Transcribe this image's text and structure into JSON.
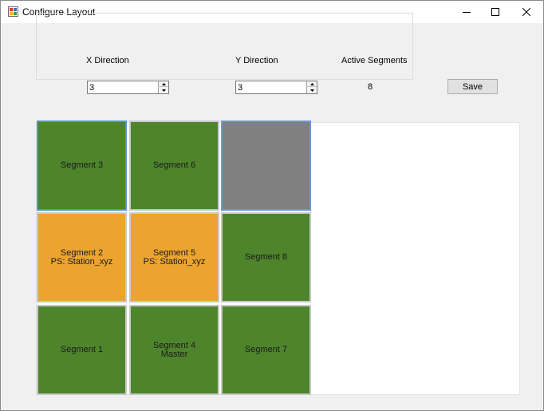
{
  "window": {
    "title": "Configure Layout",
    "icons": {
      "app": "app-icon",
      "minimize": "minimize-icon",
      "maximize": "maximize-icon",
      "close": "close-icon"
    }
  },
  "settings": {
    "x_direction": {
      "label": "X Direction",
      "value": "3"
    },
    "y_direction": {
      "label": "Y Direction",
      "value": "3"
    },
    "active_segments": {
      "label": "Active Segments",
      "value": "8"
    },
    "save_label": "Save"
  },
  "tiles": {
    "t1": {
      "line1": "Segment 3",
      "line2": ""
    },
    "t2": {
      "line1": "Segment 6",
      "line2": ""
    },
    "t3": {
      "line1": "",
      "line2": ""
    },
    "t4": {
      "line1": "Segment 2",
      "line2": "PS: Station_xyz"
    },
    "t5": {
      "line1": "Segment 5",
      "line2": "PS: Station_xyz"
    },
    "t6": {
      "line1": "Segment 8",
      "line2": ""
    },
    "t7": {
      "line1": "Segment 1",
      "line2": ""
    },
    "t8": {
      "line1": "Segment 4",
      "line2": "Master"
    },
    "t9": {
      "line1": "Segment 7",
      "line2": ""
    }
  },
  "colors": {
    "active": "#4e852c",
    "assigned": "#eba430",
    "empty": "#808080"
  }
}
